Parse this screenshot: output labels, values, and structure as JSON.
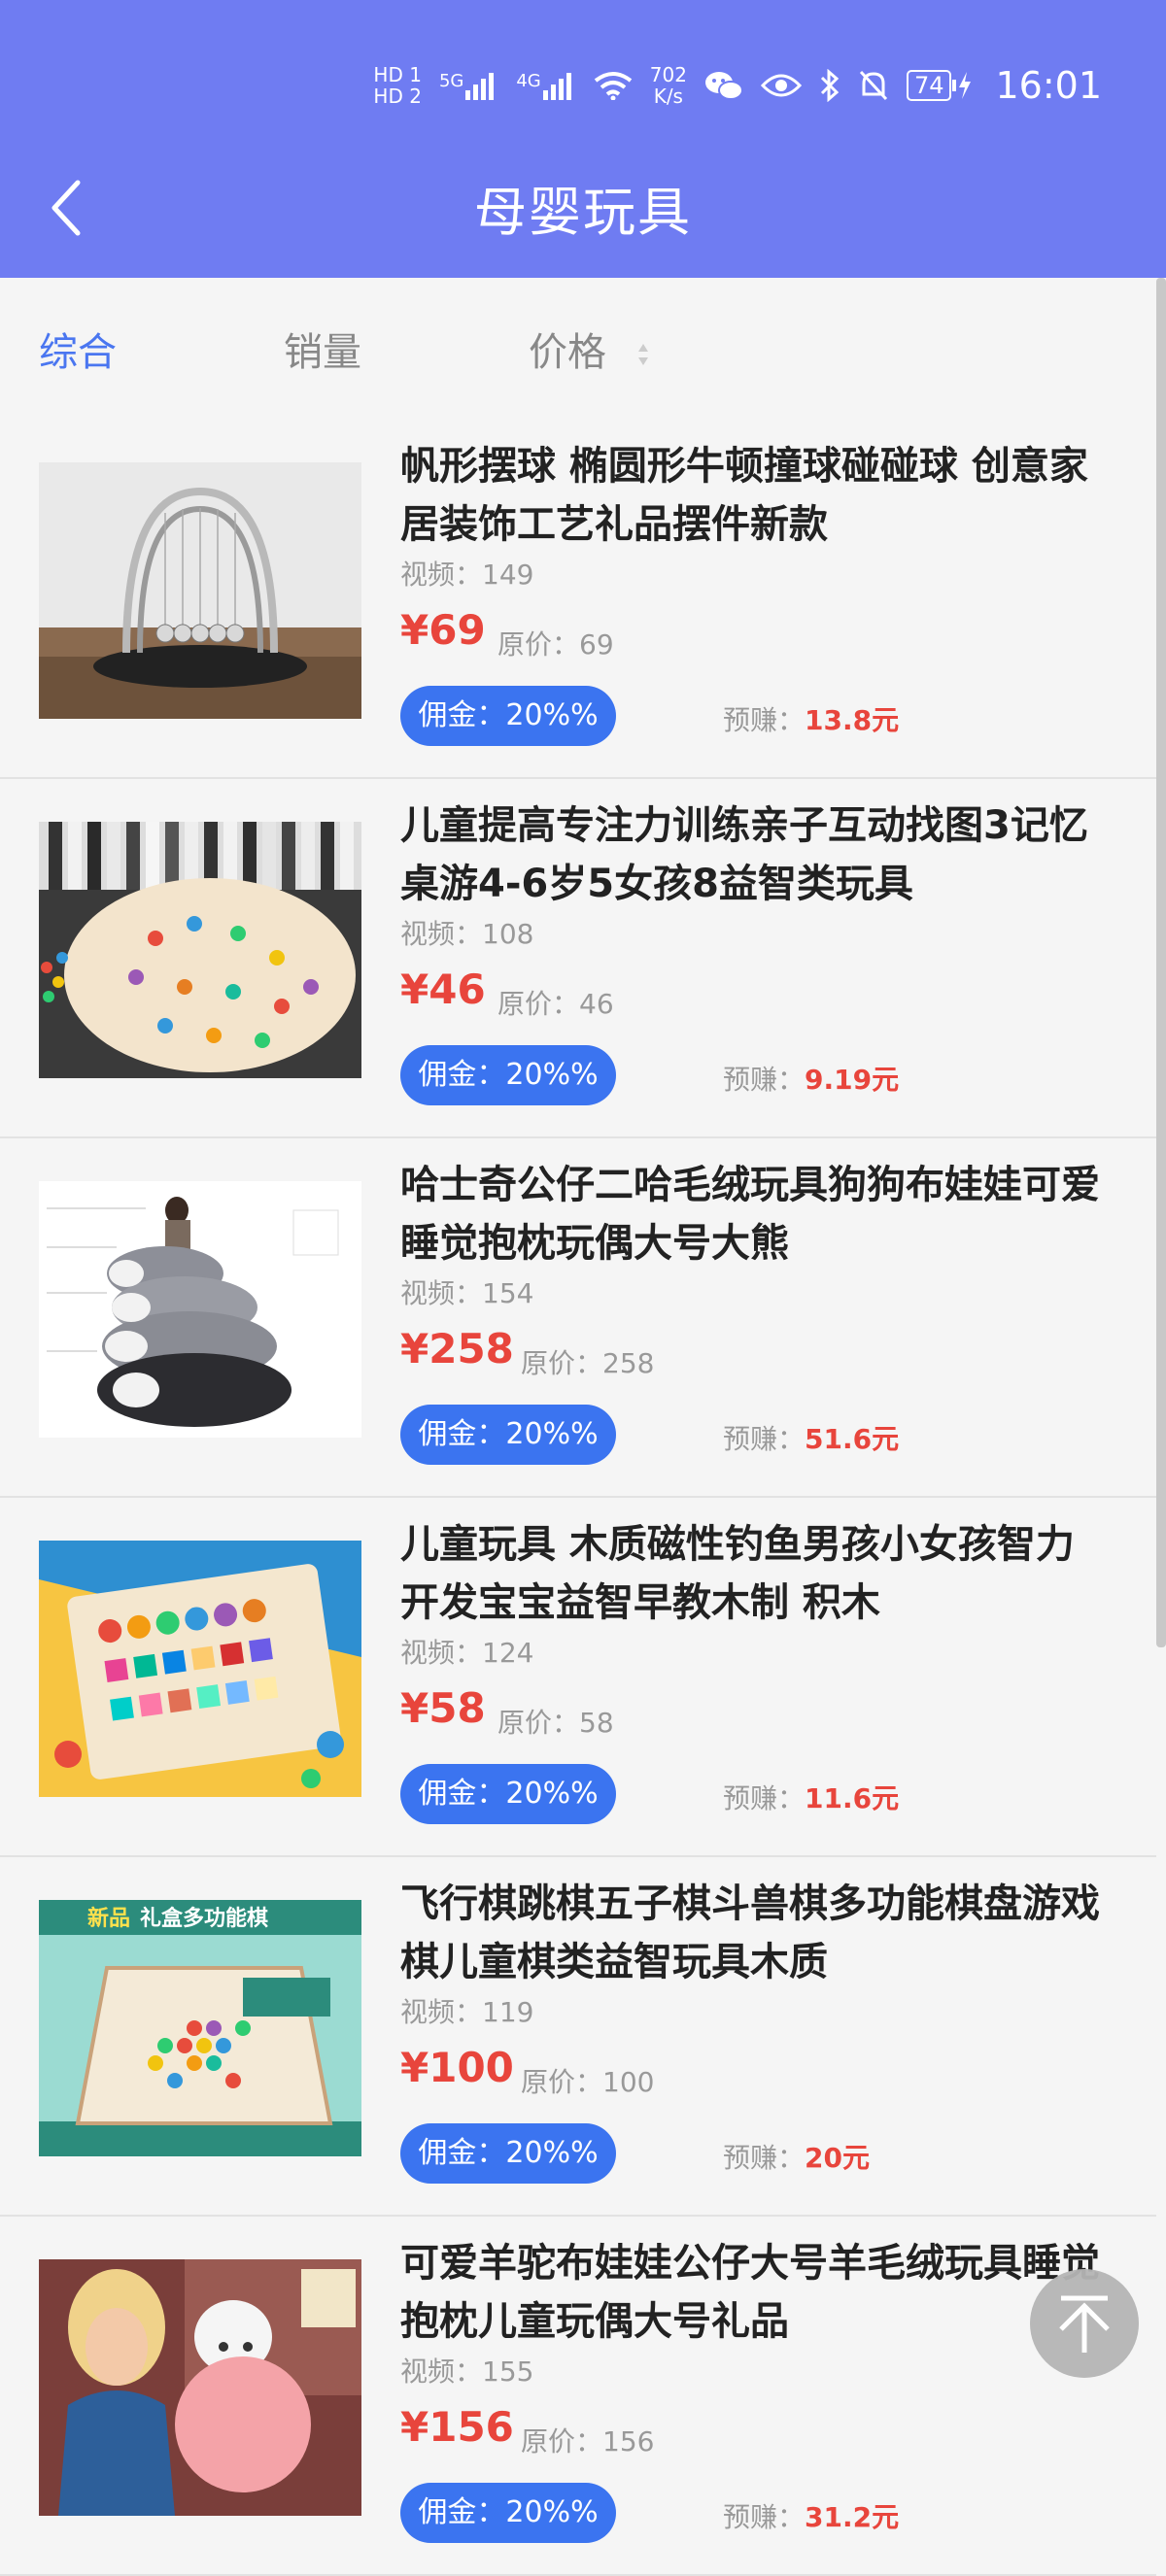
{
  "status_bar": {
    "hd1": "HD 1",
    "hd2": "HD 2",
    "net5g": "5G",
    "net4g": "4G",
    "speed_value": "702",
    "speed_unit": "K/s",
    "battery": "74",
    "time": "16:01"
  },
  "header": {
    "title": "母婴玩具",
    "back_icon": "chevron-left-icon"
  },
  "sort": {
    "items": [
      "综合",
      "销量",
      "价格"
    ],
    "active_index": 0,
    "accent": "#4a76f0"
  },
  "colors": {
    "header_bg": "#6f7cf2",
    "price": "#e8453c",
    "badge": "#3b74f0"
  },
  "products": [
    {
      "title": "帆形摆球 椭圆形牛顿撞球碰碰球 创意家居装饰工艺礼品摆件新款",
      "video_label": "视频：",
      "video": "149",
      "price": "¥69",
      "orig_label": "原价：",
      "orig": "69",
      "commission": "佣金：20%%",
      "earn_label": "预赚：",
      "earn": "13.8元"
    },
    {
      "title": "儿童提高专注力训练亲子互动找图3记忆桌游4-6岁5女孩8益智类玩具",
      "video_label": "视频：",
      "video": "108",
      "price": "¥46",
      "orig_label": "原价：",
      "orig": "46",
      "commission": "佣金：20%%",
      "earn_label": "预赚：",
      "earn": "9.19元"
    },
    {
      "title": "哈士奇公仔二哈毛绒玩具狗狗布娃娃可爱睡觉抱枕玩偶大号大熊",
      "video_label": "视频：",
      "video": "154",
      "price": "¥258",
      "orig_label": "原价：",
      "orig": "258",
      "commission": "佣金：20%%",
      "earn_label": "预赚：",
      "earn": "51.6元"
    },
    {
      "title": "儿童玩具 木质磁性钓鱼男孩小女孩智力开发宝宝益智早教木制 积木",
      "video_label": "视频：",
      "video": "124",
      "price": "¥58",
      "orig_label": "原价：",
      "orig": "58",
      "commission": "佣金：20%%",
      "earn_label": "预赚：",
      "earn": "11.6元"
    },
    {
      "title": "飞行棋跳棋五子棋斗兽棋多功能棋盘游戏棋儿童棋类益智玩具木质",
      "video_label": "视频：",
      "video": "119",
      "price": "¥100",
      "orig_label": "原价：",
      "orig": "100",
      "commission": "佣金：20%%",
      "earn_label": "预赚：",
      "earn": "20元",
      "image_banner_new": "新品",
      "image_banner_text": "礼盒多功能棋"
    },
    {
      "title": "可爱羊驼布娃娃公仔大号羊毛绒玩具睡觉抱枕儿童玩偶大号礼品",
      "video_label": "视频：",
      "video": "155",
      "price": "¥156",
      "orig_label": "原价：",
      "orig": "156",
      "commission": "佣金：20%%",
      "earn_label": "预赚：",
      "earn": "31.2元"
    }
  ],
  "back_to_top_icon": "arrow-up-icon"
}
